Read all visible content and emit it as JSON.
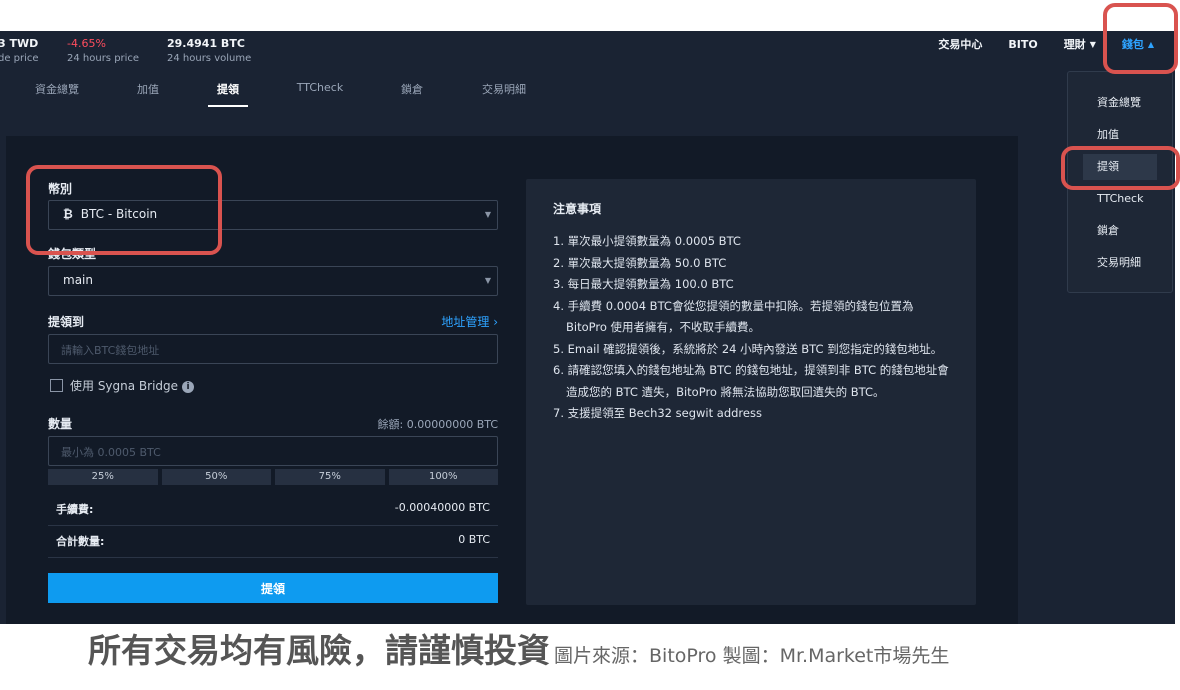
{
  "ticker": [
    {
      "value": "3 TWD",
      "label": "de price"
    },
    {
      "value": "-4.65%",
      "label": "24 hours price"
    },
    {
      "value": "29.4941 BTC",
      "label": "24 hours volume"
    }
  ],
  "topnav": {
    "items": [
      "交易中心",
      "BITO",
      "理財",
      "錢包"
    ]
  },
  "subtabs": [
    "資金總覽",
    "加值",
    "提領",
    "TTCheck",
    "鎖倉",
    "交易明細"
  ],
  "form": {
    "currency_label": "幣別",
    "currency_value": "BTC - Bitcoin",
    "currency_icon": "bitcoin-icon",
    "wallet_type_label": "錢包類型",
    "wallet_type_value": "main",
    "withdraw_to_label": "提領到",
    "address_manage_link": "地址管理",
    "address_placeholder": "請輸入BTC錢包地址",
    "sygna_label": "使用 Sygna Bridge",
    "amount_label": "數量",
    "balance": "餘額: 0.00000000 BTC",
    "amount_placeholder": "最小為 0.0005 BTC",
    "percent_buttons": [
      "25%",
      "50%",
      "75%",
      "100%"
    ],
    "fee_label": "手續費:",
    "fee_value": "-0.00040000 BTC",
    "total_label": "合計數量:",
    "total_value": "0 BTC",
    "submit_label": "提領"
  },
  "notes": {
    "title": "注意事項",
    "items": [
      "1. 單次最小提領數量為 0.0005 BTC",
      "2. 單次最大提領數量為 50.0 BTC",
      "3. 每日最大提領數量為 100.0 BTC",
      "4. 手續費 0.0004 BTC會從您提領的數量中扣除。若提領的錢包位置為 BitoPro 使用者擁有，不收取手續費。",
      "5. Email 確認提領後，系統將於 24 小時內發送 BTC 到您指定的錢包地址。",
      "6. 請確認您填入的錢包地址為 BTC 的錢包地址，提領到非 BTC 的錢包地址會造成您的 BTC 遺失，BitoPro 將無法協助您取回遺失的 BTC。",
      "7. 支援提領至 Bech32 segwit address"
    ]
  },
  "wallet_menu": [
    "資金總覽",
    "加值",
    "提領",
    "TTCheck",
    "鎖倉",
    "交易明細"
  ],
  "caption": {
    "main": "所有交易均有風險，請謹慎投資",
    "source": "圖片來源：BitoPro  製圖：Mr.Market市場先生"
  },
  "colors": {
    "background": "#1a2333",
    "panel": "#121a27",
    "accent": "#0e9bf0",
    "negative": "#ff4d5e",
    "highlight": "#d9534f"
  }
}
